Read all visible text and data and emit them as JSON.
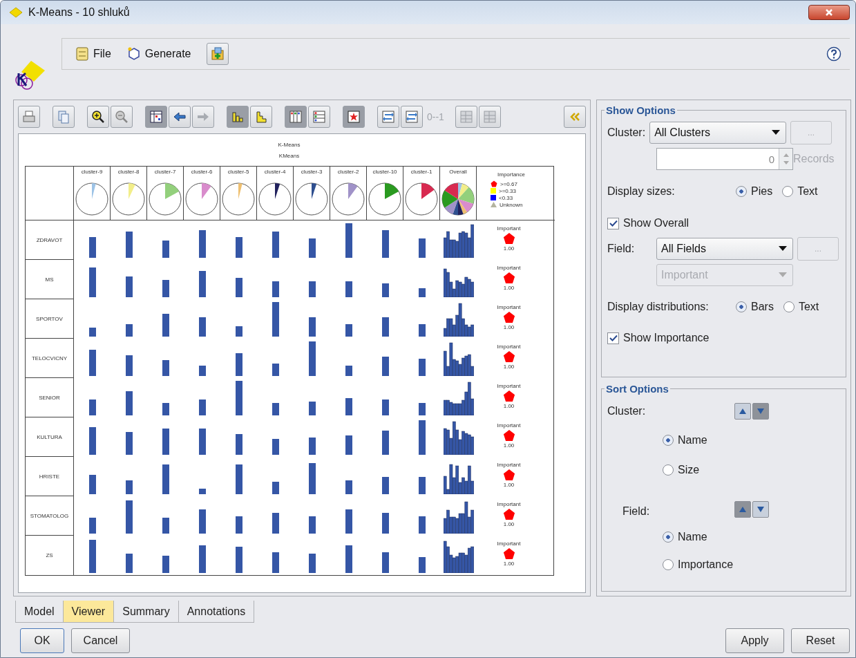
{
  "window": {
    "title": "K-Means - 10 shluků"
  },
  "menu": [
    {
      "label": "File"
    },
    {
      "label": "Generate"
    }
  ],
  "viewer": {
    "page_indicator": "0--1",
    "chart_title": "K-Means",
    "chart_subtitle": "KMeans",
    "clusters": [
      {
        "name": "cluster-9",
        "color": "#9dc3e6"
      },
      {
        "name": "cluster-8",
        "color": "#f2ee8a"
      },
      {
        "name": "cluster-7",
        "color": "#93d07c"
      },
      {
        "name": "cluster-6",
        "color": "#d98ccc"
      },
      {
        "name": "cluster-5",
        "color": "#efc070"
      },
      {
        "name": "cluster-4",
        "color": "#22225e"
      },
      {
        "name": "cluster-3",
        "color": "#2f4f8f"
      },
      {
        "name": "cluster-2",
        "color": "#a092c8"
      },
      {
        "name": "cluster-10",
        "color": "#2a9a20"
      },
      {
        "name": "cluster-1",
        "color": "#d82a50"
      }
    ],
    "overall_label": "Overall",
    "legend": {
      "title": "Importance",
      "items": [
        {
          "kind": "pentagon",
          "label": ">=0.67",
          "color": "#ff0000"
        },
        {
          "kind": "square",
          "label": ">=0.33",
          "color": "#ffff00"
        },
        {
          "kind": "square",
          "label": "<0.33",
          "color": "#0000ff"
        },
        {
          "kind": "triangle",
          "label": "Unknown",
          "color": "#b4b4a0"
        }
      ]
    },
    "fields": [
      {
        "name": "ZDRAVOT",
        "importance": "Important",
        "value": "1.00",
        "color": "#ff0000"
      },
      {
        "name": "MS",
        "importance": "Important",
        "value": "1.00",
        "color": "#ff0000"
      },
      {
        "name": "SPORTOV",
        "importance": "Important",
        "value": "1.00",
        "color": "#ff0000"
      },
      {
        "name": "TELOCVICNY",
        "importance": "Important",
        "value": "1.00",
        "color": "#ff0000"
      },
      {
        "name": "SENIOR",
        "importance": "Important",
        "value": "1.00",
        "color": "#ff0000"
      },
      {
        "name": "KULTURA",
        "importance": "Important",
        "value": "1.00",
        "color": "#ff0000"
      },
      {
        "name": "HRISTE",
        "importance": "Important",
        "value": "1.00",
        "color": "#ff0000"
      },
      {
        "name": "STOMATOLOG",
        "importance": "Important",
        "value": "1.00",
        "color": "#ff0000"
      },
      {
        "name": "ZS",
        "importance": "Important",
        "value": "1.00",
        "color": "#ff0000"
      }
    ]
  },
  "tabs": [
    {
      "label": "Model",
      "selected": false
    },
    {
      "label": "Viewer",
      "selected": true
    },
    {
      "label": "Summary",
      "selected": false
    },
    {
      "label": "Annotations",
      "selected": false
    }
  ],
  "show_options": {
    "title": "Show Options",
    "cluster": {
      "label": "Cluster:",
      "value": "All Clusters",
      "more": "...",
      "records_value": "0",
      "records_label": "Records",
      "records_disabled": true
    },
    "display_sizes": {
      "label": "Display sizes:",
      "options": [
        {
          "label": "Pies",
          "selected": true
        },
        {
          "label": "Text",
          "selected": false
        }
      ]
    },
    "show_overall": {
      "label": "Show Overall",
      "checked": true
    },
    "field": {
      "label": "Field:",
      "value": "All Fields",
      "more": "...",
      "filter_value": "Important",
      "filter_disabled": true
    },
    "display_distributions": {
      "label": "Display distributions:",
      "options": [
        {
          "label": "Bars",
          "selected": true
        },
        {
          "label": "Text",
          "selected": false
        }
      ]
    },
    "show_importance": {
      "label": "Show Importance",
      "checked": true
    }
  },
  "sort_options": {
    "title": "Sort Options",
    "groups": [
      {
        "label": "Cluster:",
        "up_selected": false,
        "down_selected": true,
        "options": [
          {
            "label": "Name",
            "selected": true
          },
          {
            "label": "Size",
            "selected": false
          }
        ]
      },
      {
        "label": "Field:",
        "up_selected": true,
        "down_selected": false,
        "options": [
          {
            "label": "Name",
            "selected": true
          },
          {
            "label": "Importance",
            "selected": false
          }
        ]
      }
    ]
  },
  "buttons": {
    "left": [
      {
        "label": "OK",
        "default": true
      },
      {
        "label": "Cancel",
        "default": false
      }
    ],
    "right": [
      {
        "label": "Apply",
        "default": false
      },
      {
        "label": "Reset",
        "default": false
      }
    ]
  }
}
